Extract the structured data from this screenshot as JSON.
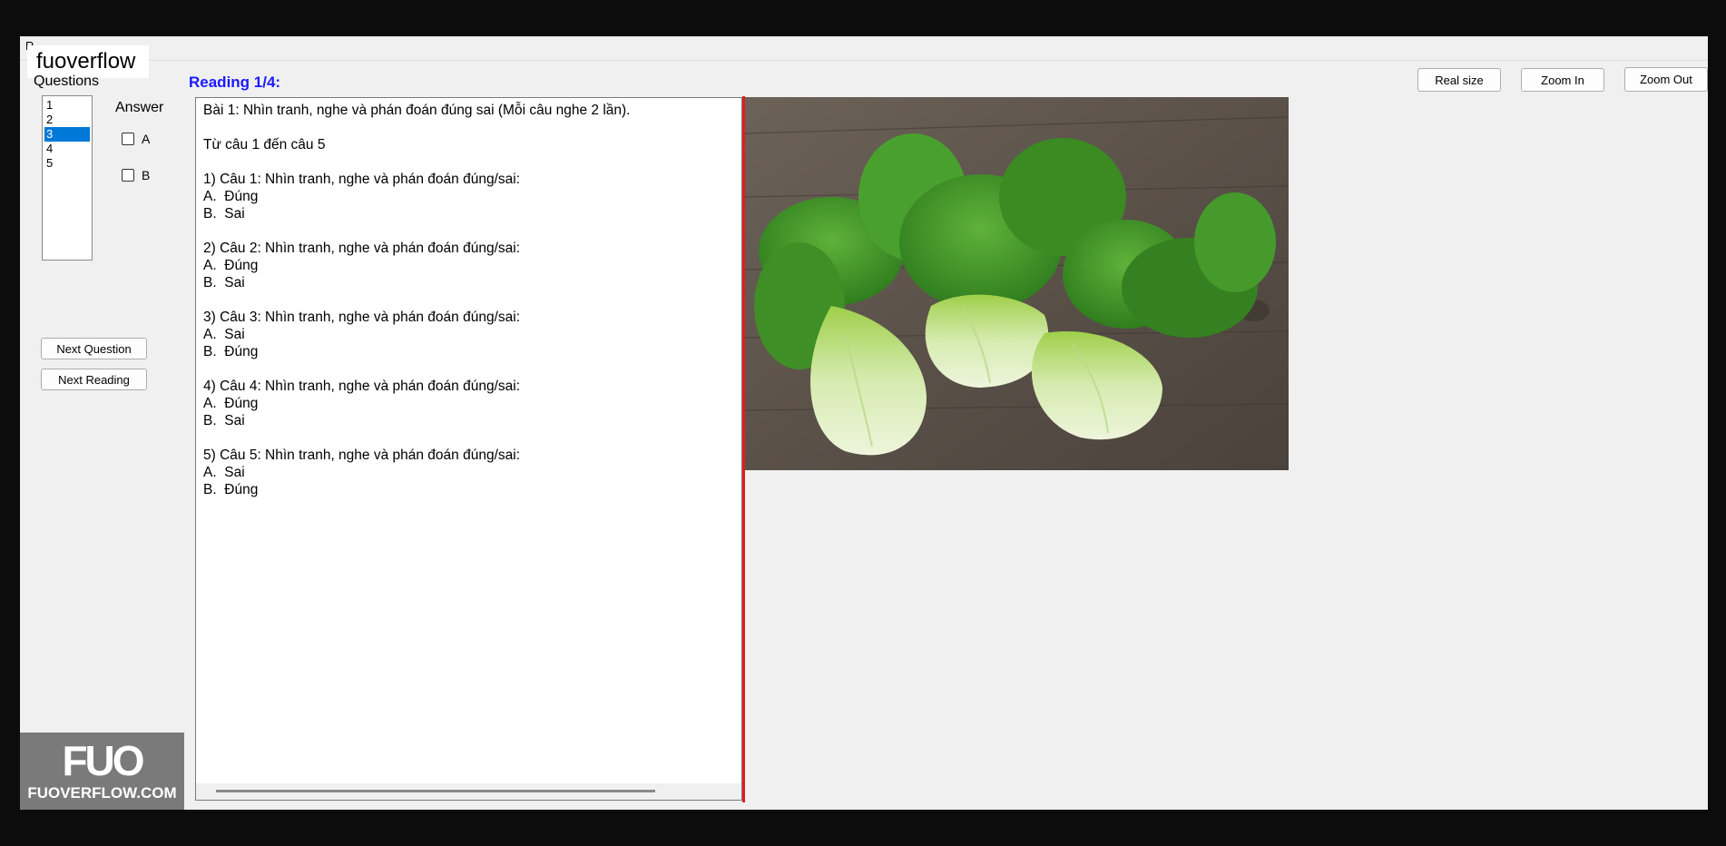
{
  "window": {
    "tab_label": "R...",
    "watermark_top": "fuoverflow"
  },
  "left_panel": {
    "questions_label": "Questions",
    "question_items": [
      "1",
      "2",
      "3",
      "4",
      "5"
    ],
    "selected_question": "3",
    "answer_label": "Answer",
    "options": [
      "A",
      "B"
    ],
    "next_question_label": "Next Question",
    "next_reading_label": "Next Reading"
  },
  "reading": {
    "title": "Reading 1/4:",
    "lines": [
      "Bài 1: Nhìn tranh, nghe và phán đoán đúng sai (Mỗi câu nghe 2 lần).",
      "",
      "Từ câu 1 đến câu 5",
      "",
      "1) Câu 1: Nhìn tranh, nghe và phán đoán đúng/sai:",
      "A.  Đúng",
      "B.  Sai",
      "",
      "2) Câu 2: Nhìn tranh, nghe và phán đoán đúng/sai:",
      "A.  Đúng",
      "B.  Sai",
      "",
      "3) Câu 3: Nhìn tranh, nghe và phán đoán đúng/sai:",
      "A.  Sai",
      "B.  Đúng",
      "",
      "4) Câu 4: Nhìn tranh, nghe và phán đoán đúng/sai:",
      "A.  Đúng",
      "B.  Sai",
      "",
      "5) Câu 5: Nhìn tranh, nghe và phán đoán đúng/sai:",
      "A.  Sai",
      "B.  Đúng"
    ]
  },
  "toolbar": {
    "real_size_label": "Real size",
    "zoom_in_label": "Zoom In",
    "zoom_out_label": "Zoom Out"
  },
  "watermark_bottom": {
    "logo": "FUO",
    "text": "FUOVERFLOW.COM"
  },
  "colors": {
    "selection": "#0078d7",
    "reading_title": "#1a1aff",
    "splitter": "#e01e1e"
  }
}
